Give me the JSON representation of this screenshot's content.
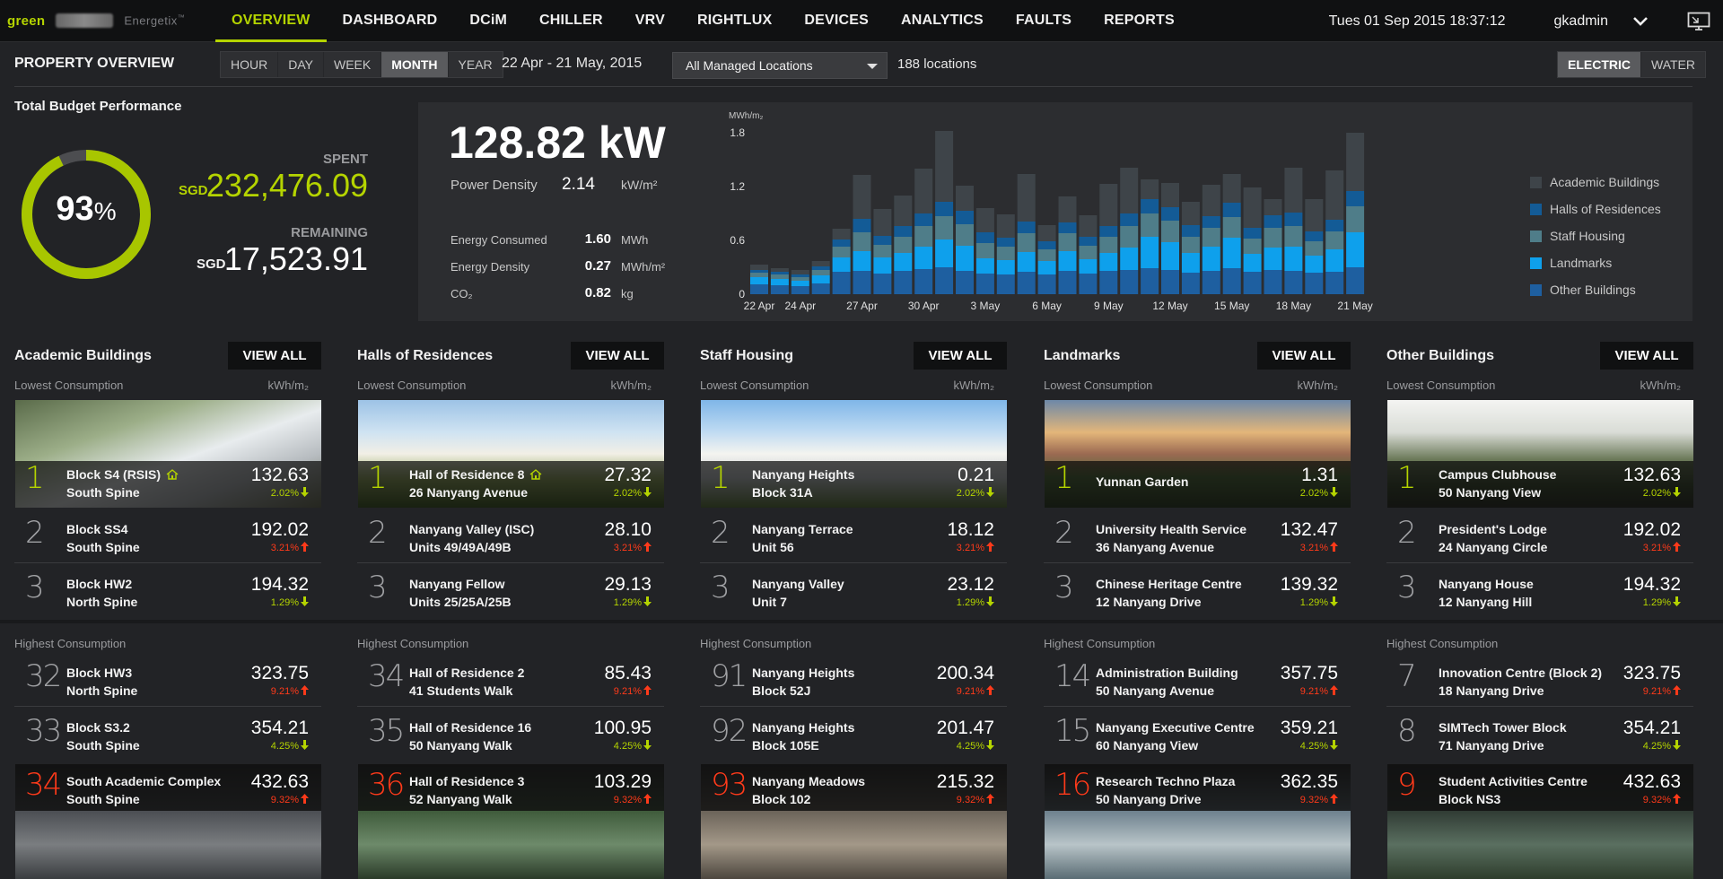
{
  "nav": {
    "logo_word": "green",
    "brand": "Energetix",
    "items": [
      {
        "label": "OVERVIEW"
      },
      {
        "label": "DASHBOARD"
      },
      {
        "label": "DCiM"
      },
      {
        "label": "CHILLER"
      },
      {
        "label": "VRV"
      },
      {
        "label": "RIGHTLUX"
      },
      {
        "label": "DEVICES"
      },
      {
        "label": "ANALYTICS"
      },
      {
        "label": "FAULTS"
      },
      {
        "label": "REPORTS"
      }
    ],
    "datetime": "Tues 01 Sep 2015  18:37:12",
    "user": "gkadmin",
    "accent": "#b5d400"
  },
  "toolbar": {
    "title": "PROPERTY OVERVIEW",
    "periods": [
      "HOUR",
      "DAY",
      "WEEK",
      "MONTH",
      "YEAR"
    ],
    "selected_period": "MONTH",
    "date_range": "22 Apr - 21 May, 2015",
    "location_select": "All Managed Locations",
    "location_count": "188 locations",
    "utilities": [
      "ELECTRIC",
      "WATER"
    ],
    "selected_utility": "ELECTRIC"
  },
  "budget": {
    "title": "Total Budget Performance",
    "percent": "93",
    "percent_sign": "%",
    "percent_value": 0.93,
    "spent_label": "SPENT",
    "currency": "SGD",
    "spent_value": "232,476.09",
    "remaining_label": "REMAINING",
    "remaining_value": "17,523.91"
  },
  "kpi": {
    "power": "128.82 kW",
    "power_density_label": "Power Density",
    "power_density_value": "2.14",
    "power_density_unit": "kW/m²",
    "rows": [
      {
        "label": "Energy Consumed",
        "value": "1.60",
        "unit": "MWh"
      },
      {
        "label": "Energy Density",
        "value": "0.27",
        "unit": "MWh/m²"
      },
      {
        "label": "CO₂",
        "value": "0.82",
        "unit": "kg"
      }
    ]
  },
  "chart_data": {
    "type": "bar",
    "stacked": true,
    "ylabel": "MWh/m₂",
    "ylim": [
      0,
      1.8
    ],
    "yticks": [
      "0",
      "0.6",
      "1.2",
      "1.8"
    ],
    "xtick_labels": [
      "22 Apr",
      "24 Apr",
      "27 Apr",
      "30 Apr",
      "3 May",
      "6 May",
      "9 May",
      "12 May",
      "15 May",
      "18 May",
      "21 May"
    ],
    "categories": [
      "22 Apr",
      "23 Apr",
      "24 Apr",
      "25 Apr",
      "26 Apr",
      "27 Apr",
      "28 Apr",
      "29 Apr",
      "30 Apr",
      "1 May",
      "2 May",
      "3 May",
      "4 May",
      "5 May",
      "6 May",
      "7 May",
      "8 May",
      "9 May",
      "10 May",
      "11 May",
      "12 May",
      "13 May",
      "14 May",
      "15 May",
      "16 May",
      "17 May",
      "18 May",
      "19 May",
      "20 May",
      "21 May"
    ],
    "series": [
      {
        "name": "Other Buildings",
        "color": "#1e5fa0",
        "values": [
          0.11,
          0.1,
          0.09,
          0.12,
          0.25,
          0.26,
          0.23,
          0.26,
          0.28,
          0.3,
          0.26,
          0.23,
          0.22,
          0.25,
          0.22,
          0.26,
          0.23,
          0.26,
          0.27,
          0.29,
          0.27,
          0.24,
          0.26,
          0.29,
          0.25,
          0.27,
          0.26,
          0.24,
          0.25,
          0.3
        ]
      },
      {
        "name": "Landmarks",
        "color": "#0ea0ec",
        "values": [
          0.08,
          0.07,
          0.06,
          0.09,
          0.16,
          0.22,
          0.18,
          0.2,
          0.25,
          0.31,
          0.28,
          0.17,
          0.16,
          0.22,
          0.15,
          0.22,
          0.16,
          0.2,
          0.25,
          0.35,
          0.31,
          0.22,
          0.27,
          0.34,
          0.2,
          0.25,
          0.27,
          0.19,
          0.25,
          0.39
        ]
      },
      {
        "name": "Staff Housing",
        "color": "#4f7d89",
        "values": [
          0.05,
          0.05,
          0.04,
          0.06,
          0.12,
          0.21,
          0.14,
          0.18,
          0.23,
          0.26,
          0.24,
          0.17,
          0.15,
          0.21,
          0.13,
          0.2,
          0.15,
          0.18,
          0.24,
          0.26,
          0.24,
          0.18,
          0.21,
          0.23,
          0.17,
          0.22,
          0.23,
          0.16,
          0.2,
          0.29
        ]
      },
      {
        "name": "Halls of Residences",
        "color": "#135b96",
        "values": [
          0.03,
          0.03,
          0.03,
          0.04,
          0.08,
          0.15,
          0.1,
          0.12,
          0.14,
          0.16,
          0.15,
          0.12,
          0.1,
          0.13,
          0.09,
          0.12,
          0.1,
          0.12,
          0.14,
          0.16,
          0.15,
          0.13,
          0.13,
          0.16,
          0.12,
          0.14,
          0.15,
          0.11,
          0.13,
          0.17
        ]
      },
      {
        "name": "Academic Buildings",
        "color": "#3e4449",
        "values": [
          0.06,
          0.04,
          0.05,
          0.06,
          0.12,
          0.49,
          0.3,
          0.34,
          0.5,
          0.79,
          0.28,
          0.27,
          0.26,
          0.53,
          0.18,
          0.29,
          0.24,
          0.47,
          0.51,
          0.22,
          0.27,
          0.26,
          0.35,
          0.32,
          0.45,
          0.18,
          0.5,
          0.36,
          0.55,
          0.65
        ]
      }
    ]
  },
  "legend": [
    {
      "name": "Academic Buildings",
      "color": "#3e4449"
    },
    {
      "name": "Halls of Residences",
      "color": "#135b96"
    },
    {
      "name": "Staff Housing",
      "color": "#4f7d89"
    },
    {
      "name": "Landmarks",
      "color": "#0ea0ec"
    },
    {
      "name": "Other Buildings",
      "color": "#1e5fa0"
    }
  ],
  "labels": {
    "view_all": "VIEW ALL",
    "lowest": "Lowest Consumption",
    "highest": "Highest Consumption",
    "unit": "kWh/m₂"
  },
  "categories": [
    {
      "title": "Academic Buildings",
      "lowest": [
        {
          "rank": "1",
          "name": "Block S4 (RSIS)",
          "sub": "South Spine",
          "value": "132.63",
          "change": "2.02%",
          "dir": "down",
          "home": true
        },
        {
          "rank": "2",
          "name": "Block SS4",
          "sub": "South Spine",
          "value": "192.02",
          "change": "3.21%",
          "dir": "up"
        },
        {
          "rank": "3",
          "name": "Block HW2",
          "sub": "North Spine",
          "value": "194.32",
          "change": "1.29%",
          "dir": "down"
        }
      ],
      "highest": [
        {
          "rank": "32",
          "name": "Block HW3",
          "sub": "North Spine",
          "value": "323.75",
          "change": "9.21%",
          "dir": "up"
        },
        {
          "rank": "33",
          "name": "Block S3.2",
          "sub": "South Spine",
          "value": "354.21",
          "change": "4.25%",
          "dir": "down"
        },
        {
          "rank": "34",
          "name": "South Academic Complex",
          "sub": "South Spine",
          "value": "432.63",
          "change": "9.32%",
          "dir": "up"
        }
      ]
    },
    {
      "title": "Halls of Residences",
      "lowest": [
        {
          "rank": "1",
          "name": "Hall of Residence 8",
          "sub": "26 Nanyang Avenue",
          "value": "27.32",
          "change": "2.02%",
          "dir": "down",
          "home": true
        },
        {
          "rank": "2",
          "name": "Nanyang Valley (ISC)",
          "sub": "Units 49/49A/49B",
          "value": "28.10",
          "change": "3.21%",
          "dir": "up"
        },
        {
          "rank": "3",
          "name": "Nanyang Fellow",
          "sub": "Units 25/25A/25B",
          "value": "29.13",
          "change": "1.29%",
          "dir": "down"
        }
      ],
      "highest": [
        {
          "rank": "34",
          "name": "Hall of Residence 2",
          "sub": "41 Students Walk",
          "value": "85.43",
          "change": "9.21%",
          "dir": "up"
        },
        {
          "rank": "35",
          "name": "Hall of Residence 16",
          "sub": "50 Nanyang Walk",
          "value": "100.95",
          "change": "4.25%",
          "dir": "down"
        },
        {
          "rank": "36",
          "name": "Hall of Residence 3",
          "sub": "52 Nanyang Walk",
          "value": "103.29",
          "change": "9.32%",
          "dir": "up"
        }
      ]
    },
    {
      "title": "Staff Housing",
      "lowest": [
        {
          "rank": "1",
          "name": "Nanyang Heights",
          "sub": "Block 31A",
          "value": "0.21",
          "change": "2.02%",
          "dir": "down"
        },
        {
          "rank": "2",
          "name": "Nanyang Terrace",
          "sub": "Unit 56",
          "value": "18.12",
          "change": "3.21%",
          "dir": "up"
        },
        {
          "rank": "3",
          "name": "Nanyang Valley",
          "sub": "Unit 7",
          "value": "23.12",
          "change": "1.29%",
          "dir": "down"
        }
      ],
      "highest": [
        {
          "rank": "91",
          "name": "Nanyang Heights",
          "sub": "Block 52J",
          "value": "200.34",
          "change": "9.21%",
          "dir": "up"
        },
        {
          "rank": "92",
          "name": "Nanyang Heights",
          "sub": "Block 105E",
          "value": "201.47",
          "change": "4.25%",
          "dir": "down"
        },
        {
          "rank": "93",
          "name": "Nanyang Meadows",
          "sub": "Block 102",
          "value": "215.32",
          "change": "9.32%",
          "dir": "up"
        }
      ]
    },
    {
      "title": "Landmarks",
      "lowest": [
        {
          "rank": "1",
          "name": "Yunnan Garden",
          "sub": "",
          "value": "1.31",
          "change": "2.02%",
          "dir": "down"
        },
        {
          "rank": "2",
          "name": "University Health Service",
          "sub": "36 Nanyang Avenue",
          "value": "132.47",
          "change": "3.21%",
          "dir": "up"
        },
        {
          "rank": "3",
          "name": "Chinese Heritage Centre",
          "sub": "12 Nanyang Drive",
          "value": "139.32",
          "change": "1.29%",
          "dir": "down"
        }
      ],
      "highest": [
        {
          "rank": "14",
          "name": "Administration Building",
          "sub": "50 Nanyang Avenue",
          "value": "357.75",
          "change": "9.21%",
          "dir": "up"
        },
        {
          "rank": "15",
          "name": "Nanyang Executive Centre",
          "sub": "60 Nanyang View",
          "value": "359.21",
          "change": "4.25%",
          "dir": "down"
        },
        {
          "rank": "16",
          "name": "Research Techno Plaza",
          "sub": "50 Nanyang Drive",
          "value": "362.35",
          "change": "9.32%",
          "dir": "up"
        }
      ]
    },
    {
      "title": "Other Buildings",
      "lowest": [
        {
          "rank": "1",
          "name": "Campus Clubhouse",
          "sub": "50 Nanyang View",
          "value": "132.63",
          "change": "2.02%",
          "dir": "down"
        },
        {
          "rank": "2",
          "name": "President's Lodge",
          "sub": "24 Nanyang Circle",
          "value": "192.02",
          "change": "3.21%",
          "dir": "up"
        },
        {
          "rank": "3",
          "name": "Nanyang House",
          "sub": "12 Nanyang Hill",
          "value": "194.32",
          "change": "1.29%",
          "dir": "down"
        }
      ],
      "highest": [
        {
          "rank": "7",
          "name": "Innovation Centre (Block 2)",
          "sub": "18 Nanyang Drive",
          "value": "323.75",
          "change": "9.21%",
          "dir": "up"
        },
        {
          "rank": "8",
          "name": "SIMTech Tower Block",
          "sub": "71 Nanyang Drive",
          "value": "354.21",
          "change": "4.25%",
          "dir": "down"
        },
        {
          "rank": "9",
          "name": "Student Activities Centre",
          "sub": "Block NS3",
          "value": "432.63",
          "change": "9.32%",
          "dir": "up"
        }
      ]
    }
  ]
}
